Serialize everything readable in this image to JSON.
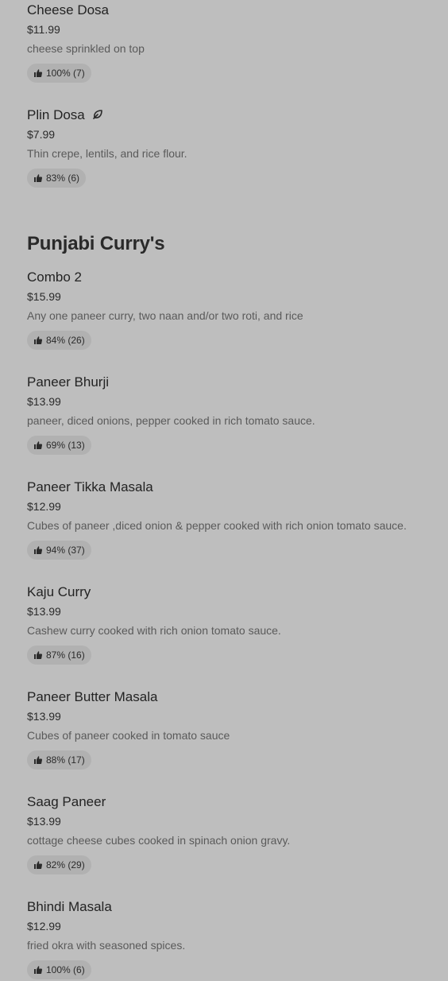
{
  "sections": [
    {
      "title": "",
      "items": [
        {
          "name": "Cheese Dosa",
          "price": "$11.99",
          "description": "cheese sprinkled on top",
          "rating": "100% (7)",
          "veg": false
        },
        {
          "name": "Plin Dosa",
          "price": "$7.99",
          "description": "Thin crepe, lentils, and rice flour.",
          "rating": "83% (6)",
          "veg": true
        }
      ]
    },
    {
      "title": "Punjabi Curry's",
      "items": [
        {
          "name": "Combo 2",
          "price": "$15.99",
          "description": "Any one paneer curry, two naan and/or two roti, and rice",
          "rating": "84% (26)"
        },
        {
          "name": "Paneer Bhurji",
          "price": "$13.99",
          "description": "paneer, diced onions, pepper cooked in rich tomato sauce.",
          "rating": "69% (13)"
        },
        {
          "name": "Paneer Tikka Masala",
          "price": "$12.99",
          "description": "Cubes of paneer ,diced onion & pepper cooked with rich onion tomato sauce.",
          "rating": "94% (37)"
        },
        {
          "name": "Kaju Curry",
          "price": "$13.99",
          "description": "Cashew curry cooked with rich onion tomato sauce.",
          "rating": "87% (16)"
        },
        {
          "name": "Paneer Butter Masala",
          "price": "$13.99",
          "description": "Cubes of paneer cooked in tomato sauce",
          "rating": "88% (17)"
        },
        {
          "name": "Saag Paneer",
          "price": "$13.99",
          "description": "cottage cheese cubes cooked in spinach onion gravy.",
          "rating": "82% (29)"
        },
        {
          "name": "Bhindi Masala",
          "price": "$12.99",
          "description": "fried okra with seasoned spices.",
          "rating": "100% (6)"
        }
      ]
    }
  ],
  "icons": {
    "rating": "thumbs-up-icon",
    "veg": "leaf-icon"
  }
}
